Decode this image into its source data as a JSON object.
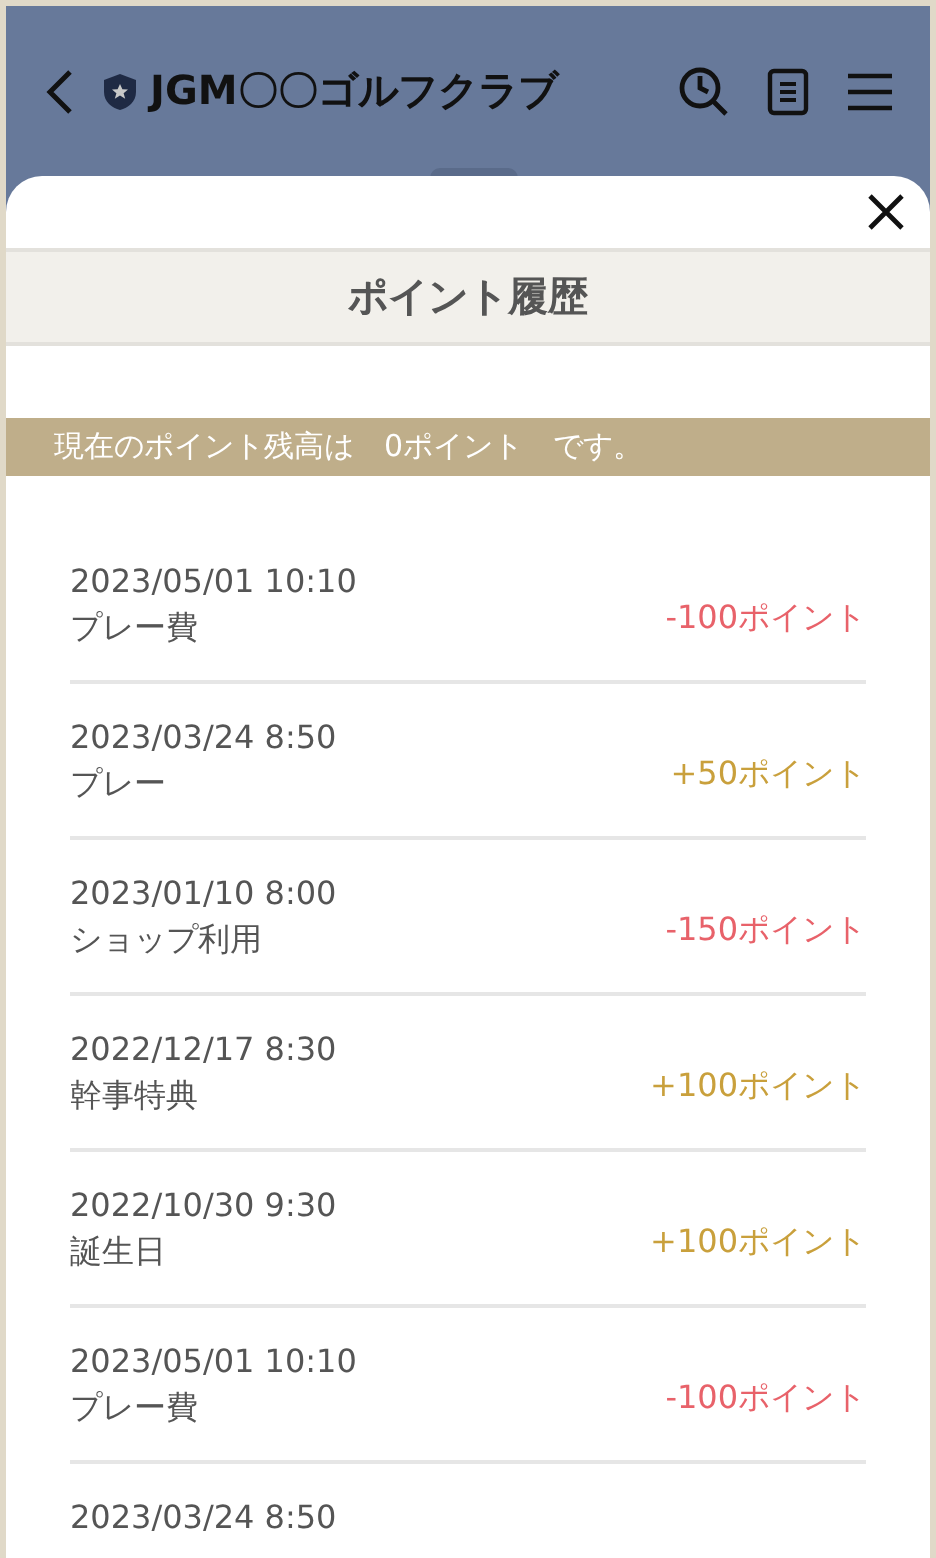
{
  "header": {
    "title": "JGM〇〇ゴルフクラブ"
  },
  "sheet": {
    "title": "ポイント履歴",
    "balance_text": "現在のポイント残高は　0ポイント　です。"
  },
  "entries": [
    {
      "date": "2023/05/01 10:10",
      "label": "プレー費",
      "points": "-100ポイント",
      "kind": "debit"
    },
    {
      "date": "2023/03/24 8:50",
      "label": "プレー",
      "points": "+50ポイント",
      "kind": "credit"
    },
    {
      "date": "2023/01/10 8:00",
      "label": "ショップ利用",
      "points": "-150ポイント",
      "kind": "debit"
    },
    {
      "date": "2022/12/17 8:30",
      "label": "幹事特典",
      "points": "+100ポイント",
      "kind": "credit"
    },
    {
      "date": "2022/10/30 9:30",
      "label": "誕生日",
      "points": "+100ポイント",
      "kind": "credit"
    },
    {
      "date": "2023/05/01 10:10",
      "label": "プレー費",
      "points": "-100ポイント",
      "kind": "debit"
    },
    {
      "date": "2023/03/24 8:50"
    }
  ]
}
